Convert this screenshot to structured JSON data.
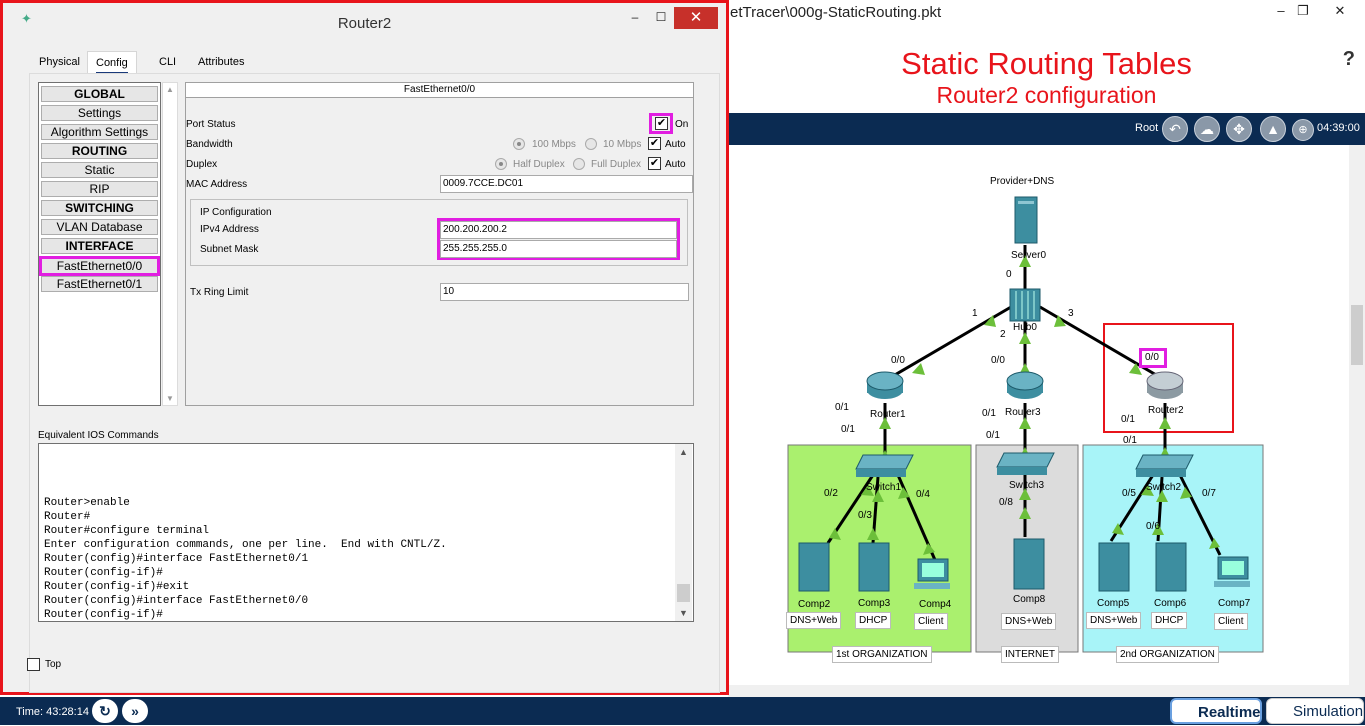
{
  "main_window": {
    "title": "etTracer\\000g-StaticRouting.pkt",
    "minimize": "–",
    "restore": "❐",
    "close": "✕"
  },
  "banner": {
    "title": "Static Routing Tables",
    "subtitle": "Router2 configuration",
    "help": "?"
  },
  "toolbar": {
    "root_label": "Root",
    "clock": "04:39:00"
  },
  "topology": {
    "server0": {
      "name": "Server0",
      "label": "Provider+DNS"
    },
    "hub0": {
      "name": "Hub0"
    },
    "router1": {
      "name": "Router1"
    },
    "router3": {
      "name": "Router3"
    },
    "router2": {
      "name": "Router2"
    },
    "switch1": {
      "name": "Switch1"
    },
    "switch3": {
      "name": "Switch3"
    },
    "switch2": {
      "name": "Switch2"
    },
    "comp2": {
      "name": "Comp2",
      "role": "DNS+Web"
    },
    "comp3": {
      "name": "Comp3",
      "role": "DHCP"
    },
    "comp4": {
      "name": "Comp4",
      "role": "Client"
    },
    "comp8": {
      "name": "Comp8",
      "role": "DNS+Web"
    },
    "comp5": {
      "name": "Comp5",
      "role": "DNS+Web"
    },
    "comp6": {
      "name": "Comp6",
      "role": "DHCP"
    },
    "comp7": {
      "name": "Comp7",
      "role": "Client"
    },
    "org1": "1st ORGANIZATION",
    "internet": "INTERNET",
    "org2": "2nd ORGANIZATION",
    "ports": {
      "hub_0": "0",
      "hub_1": "1",
      "hub_2": "2",
      "hub_3": "3",
      "r1_00": "0/0",
      "r1_01a": "0/1",
      "r1_01b": "0/1",
      "r3_00": "0/0",
      "r3_01a": "0/1",
      "r3_01b": "0/1",
      "r2_00": "0/0",
      "r2_01a": "0/1",
      "r2_01b": "0/1",
      "s1_02": "0/2",
      "s1_03": "0/3",
      "s1_04": "0/4",
      "s3_08": "0/8",
      "s2_05": "0/5",
      "s2_06": "0/6",
      "s2_07": "0/7"
    }
  },
  "status_bar": {
    "time": "Time: 43:28:14",
    "realtime": "Realtime",
    "simulation": "Simulation"
  },
  "dialog": {
    "title": "Router2",
    "minimize": "–",
    "maximize": "☐",
    "close": "✕",
    "tabs": [
      "Physical",
      "Config",
      "CLI",
      "Attributes"
    ],
    "left_menu": [
      {
        "label": "GLOBAL",
        "header": true
      },
      {
        "label": "Settings",
        "header": false
      },
      {
        "label": "Algorithm Settings",
        "header": false
      },
      {
        "label": "ROUTING",
        "header": true
      },
      {
        "label": "Static",
        "header": false
      },
      {
        "label": "RIP",
        "header": false
      },
      {
        "label": "SWITCHING",
        "header": true
      },
      {
        "label": "VLAN Database",
        "header": false
      },
      {
        "label": "INTERFACE",
        "header": true
      },
      {
        "label": "FastEthernet0/0",
        "header": false
      },
      {
        "label": "FastEthernet0/1",
        "header": false
      }
    ],
    "interface": {
      "header": "FastEthernet0/0",
      "port_status_label": "Port Status",
      "port_status_on": "On",
      "bandwidth_label": "Bandwidth",
      "bw_100": "100 Mbps",
      "bw_10": "10 Mbps",
      "auto": "Auto",
      "duplex_label": "Duplex",
      "half": "Half Duplex",
      "full": "Full Duplex",
      "mac_label": "MAC Address",
      "mac_value": "0009.7CCE.DC01",
      "ip_config_label": "IP Configuration",
      "ipv4_label": "IPv4 Address",
      "ipv4_value": "200.200.200.2",
      "mask_label": "Subnet Mask",
      "mask_value": "255.255.255.0",
      "tx_label": "Tx Ring Limit",
      "tx_value": "10"
    },
    "ios_label": "Equivalent IOS Commands",
    "ios_lines": "Router>enable\nRouter#\nRouter#configure terminal\nEnter configuration commands, one per line.  End with CNTL/Z.\nRouter(config)#interface FastEthernet0/1\nRouter(config-if)#\nRouter(config-if)#exit\nRouter(config)#interface FastEthernet0/0\nRouter(config-if)#",
    "top_label": "Top"
  }
}
